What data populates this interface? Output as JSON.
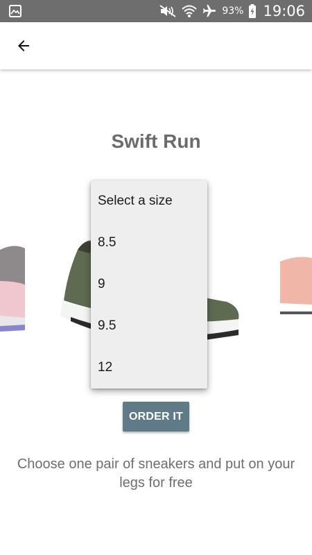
{
  "status_bar": {
    "battery_percent": "93%",
    "time": "19:06",
    "icons": [
      "image-icon",
      "mute-icon",
      "wifi-icon",
      "airplane-icon",
      "battery-charging-icon"
    ]
  },
  "app_bar": {
    "back_icon": "arrow-back-icon"
  },
  "product": {
    "title": "Swift Run"
  },
  "size_dropdown": {
    "options": [
      "Select a size",
      "8.5",
      "9",
      "9.5",
      "12"
    ]
  },
  "actions": {
    "order_label": "ORDER IT"
  },
  "description": "Choose one pair of sneakers and put on your legs for free",
  "colors": {
    "status_bar": "#6e6e6e",
    "primary_button": "#5f7b88",
    "dropdown_bg": "#eeeeee",
    "title_text": "#6b6b6b"
  }
}
